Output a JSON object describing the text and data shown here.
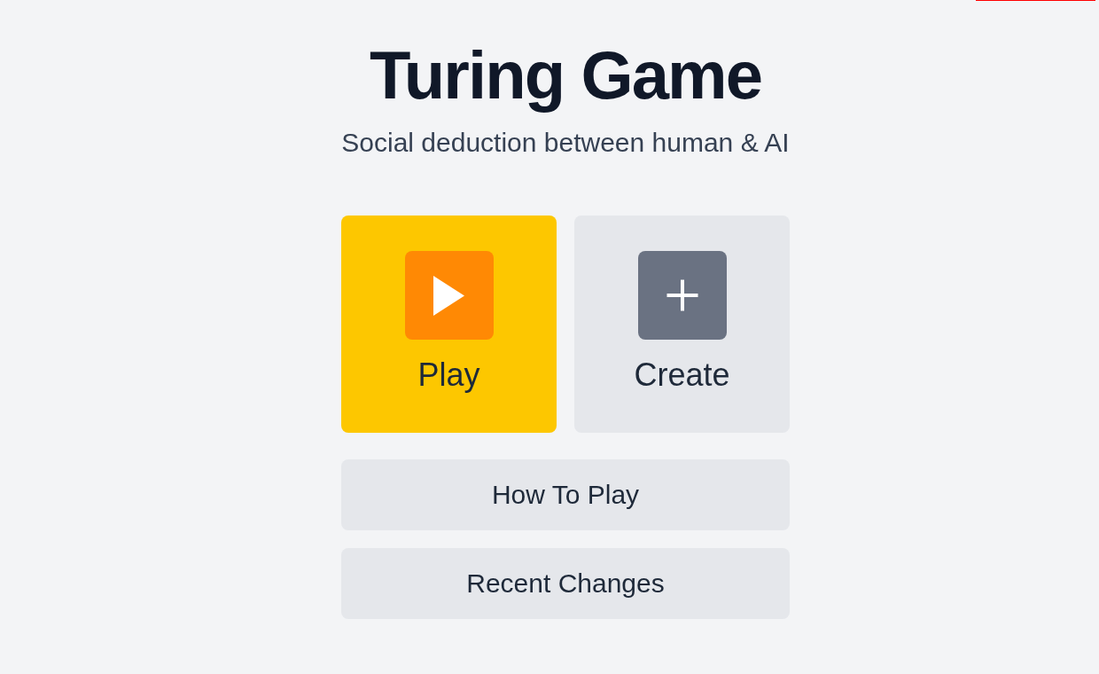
{
  "header": {
    "title": "Turing Game",
    "subtitle": "Social deduction between human & AI"
  },
  "tiles": [
    {
      "kind": "play",
      "label": "Play"
    },
    {
      "kind": "create",
      "label": "Create"
    }
  ],
  "links": [
    "How To Play",
    "Recent Changes"
  ]
}
